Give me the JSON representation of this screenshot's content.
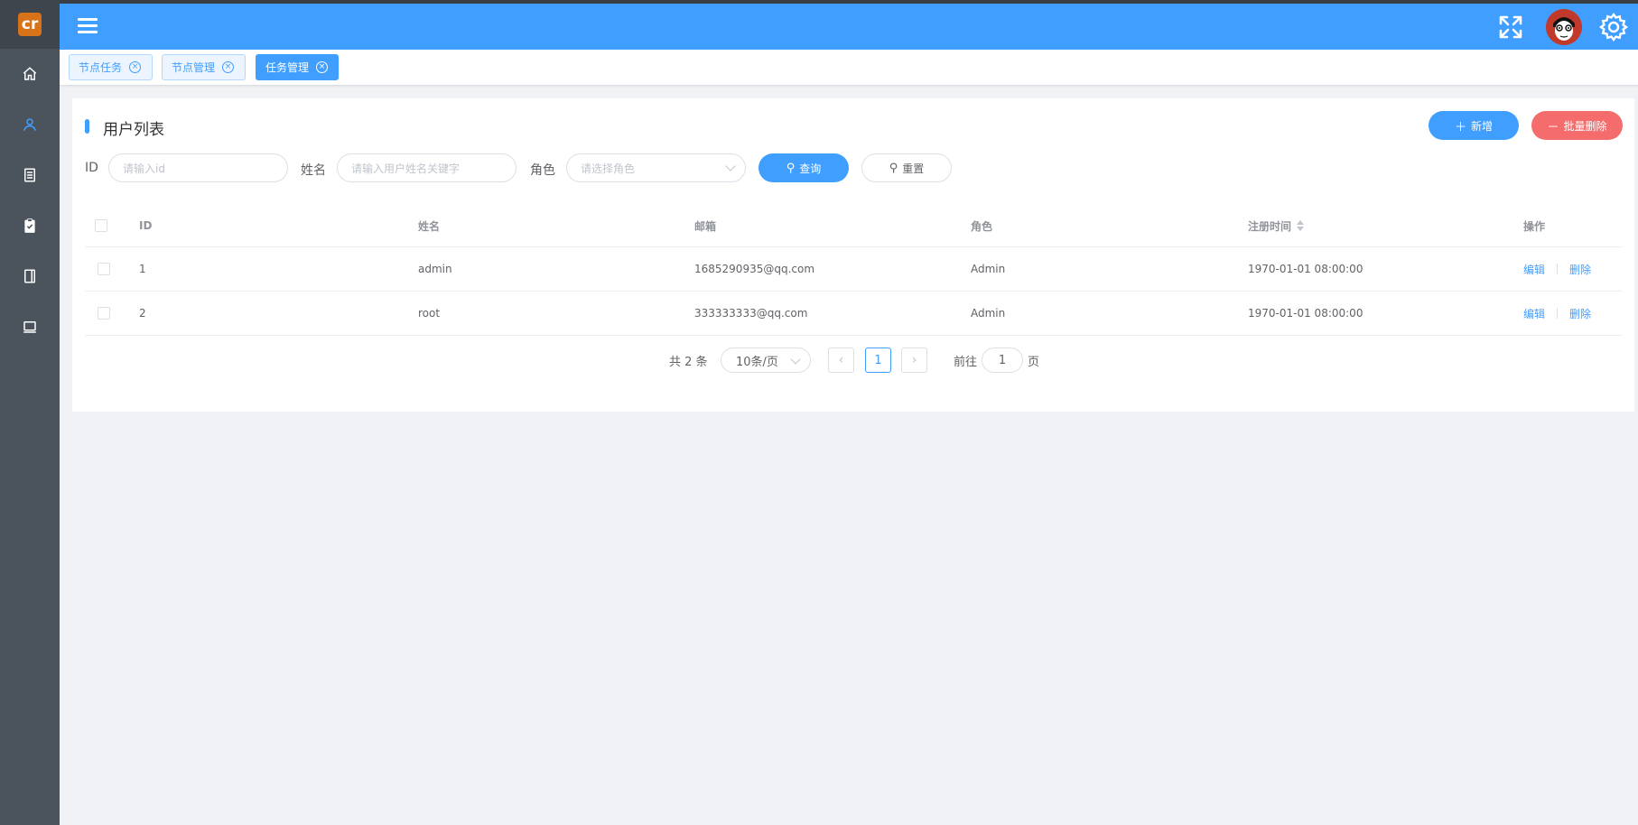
{
  "app": {
    "logo_text": "cr"
  },
  "sidebar": {
    "items": [
      {
        "name": "home",
        "icon": "home-icon",
        "active": false
      },
      {
        "name": "user",
        "icon": "user-icon",
        "active": true
      },
      {
        "name": "document",
        "icon": "document-icon",
        "active": false
      },
      {
        "name": "clipboard",
        "icon": "clipboard-check-icon",
        "active": false
      },
      {
        "name": "notebook",
        "icon": "notebook-icon",
        "active": false
      },
      {
        "name": "monitor",
        "icon": "monitor-icon",
        "active": false
      }
    ]
  },
  "tags": [
    {
      "label": "节点任务",
      "active": false
    },
    {
      "label": "节点管理",
      "active": false
    },
    {
      "label": "任务管理",
      "active": true
    }
  ],
  "card": {
    "title": "用户列表",
    "add_label": "新增",
    "batch_delete_label": "批量删除"
  },
  "search": {
    "id_label": "ID",
    "id_placeholder": "请输入id",
    "name_label": "姓名",
    "name_placeholder": "请输入用户姓名关键字",
    "role_label": "角色",
    "role_placeholder": "请选择角色",
    "query_label": "查询",
    "reset_label": "重置"
  },
  "table": {
    "headers": {
      "id": "ID",
      "name": "姓名",
      "email": "邮箱",
      "role": "角色",
      "reg_time": "注册时间",
      "ops": "操作"
    },
    "rows": [
      {
        "id": "1",
        "name": "admin",
        "email": "1685290935@qq.com",
        "role": "Admin",
        "reg_time": "1970-01-01 08:00:00",
        "edit": "编辑",
        "delete": "删除"
      },
      {
        "id": "2",
        "name": "root",
        "email": "333333333@qq.com",
        "role": "Admin",
        "reg_time": "1970-01-01 08:00:00",
        "edit": "编辑",
        "delete": "删除"
      }
    ]
  },
  "pagination": {
    "total_text": "共 2 条",
    "page_size": "10条/页",
    "current_page": "1",
    "goto_label": "前往",
    "goto_value": "1",
    "page_suffix": "页"
  },
  "colors": {
    "primary": "#409eff",
    "danger": "#f56c6c",
    "sidebar": "#4b535c",
    "logo": "#d9731a"
  }
}
